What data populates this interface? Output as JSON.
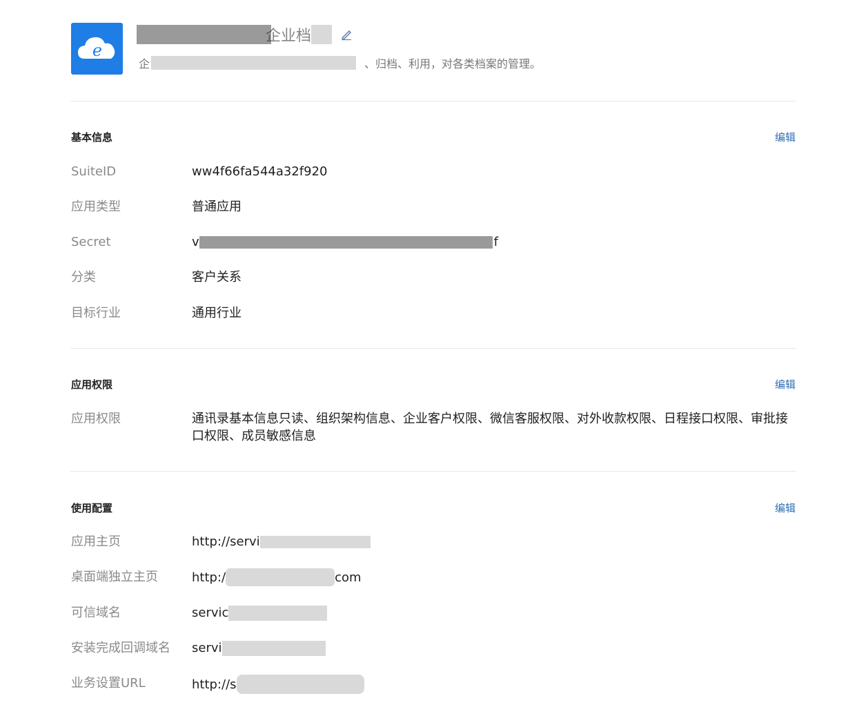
{
  "header": {
    "app_name_suffix": "企业档",
    "description_prefix": "企",
    "description_suffix": "、归档、利用，对各类档案的管理。",
    "icon_color": "#1f7de6"
  },
  "sections": {
    "basic": {
      "title": "基本信息",
      "edit_label": "编辑",
      "rows": [
        {
          "label": "SuiteID",
          "value": "ww4f66fa544a32f920"
        },
        {
          "label": "应用类型",
          "value": "普通应用"
        },
        {
          "label": "Secret",
          "value_prefix": "v",
          "value_suffix": "f"
        },
        {
          "label": "分类",
          "value": "客户关系"
        },
        {
          "label": "目标行业",
          "value": "通用行业"
        }
      ]
    },
    "permissions": {
      "title": "应用权限",
      "edit_label": "编辑",
      "rows": [
        {
          "label": "应用权限",
          "value": "通讯录基本信息只读、组织架构信息、企业客户权限、微信客服权限、对外收款权限、日程接口权限、审批接口权限、成员敏感信息"
        }
      ]
    },
    "config": {
      "title": "使用配置",
      "edit_label": "编辑",
      "rows": [
        {
          "label": "应用主页",
          "value_prefix": "http://servi"
        },
        {
          "label": "桌面端独立主页",
          "value_prefix": "http:/",
          "value_suffix": "com"
        },
        {
          "label": "可信域名",
          "value_prefix": "servic"
        },
        {
          "label": "安装完成回调域名",
          "value_prefix": "servi"
        },
        {
          "label": "业务设置URL",
          "value_prefix": "http://s"
        }
      ]
    }
  },
  "colors": {
    "link": "#2f6fb3",
    "label": "#8a8a8a",
    "divider": "#e6e6e6"
  }
}
